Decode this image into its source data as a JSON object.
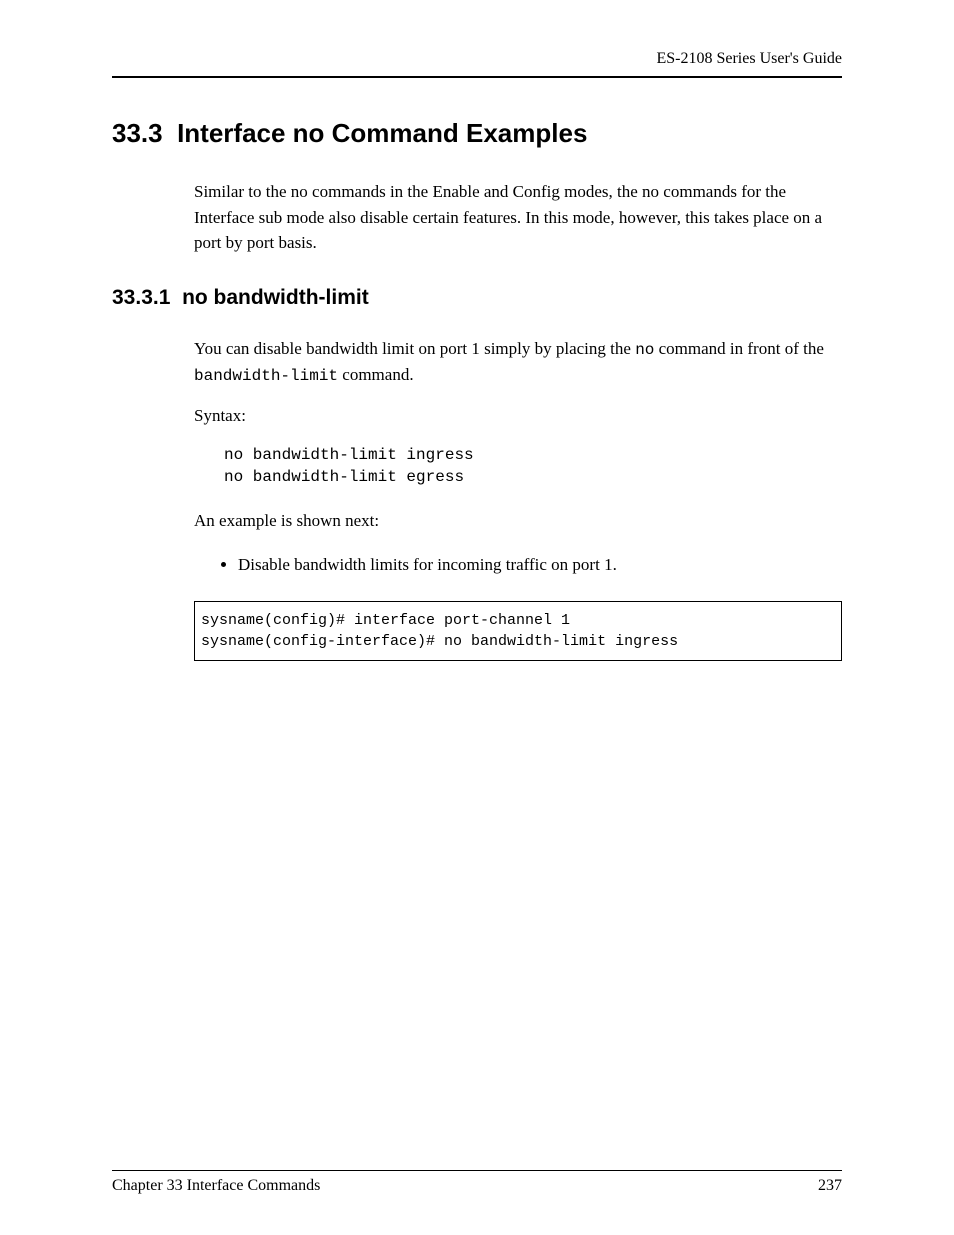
{
  "header": {
    "guide_title": "ES-2108 Series User's Guide"
  },
  "section": {
    "number": "33.3",
    "title": "Interface no Command Examples",
    "intro": "Similar to the no commands in the Enable and Config modes, the no commands for the Interface sub mode also disable certain features. In this mode, however, this takes place on a port by port basis."
  },
  "subsection": {
    "number": "33.3.1",
    "title": "no bandwidth-limit",
    "intro_prefix": "You can disable bandwidth limit on port 1 simply by placing the ",
    "intro_mono1": "no",
    "intro_mid": " command in front of the ",
    "intro_mono2": "bandwidth-limit",
    "intro_suffix": " command.",
    "syntax_label": "Syntax:",
    "syntax_code": "no bandwidth-limit ingress\nno bandwidth-limit egress",
    "example_intro": "An example is shown next:",
    "bullet1": "Disable bandwidth limits for incoming traffic on port 1.",
    "example_code": "sysname(config)# interface port-channel 1\nsysname(config-interface)# no bandwidth-limit ingress"
  },
  "footer": {
    "chapter": "Chapter 33 Interface Commands",
    "page": "237"
  }
}
